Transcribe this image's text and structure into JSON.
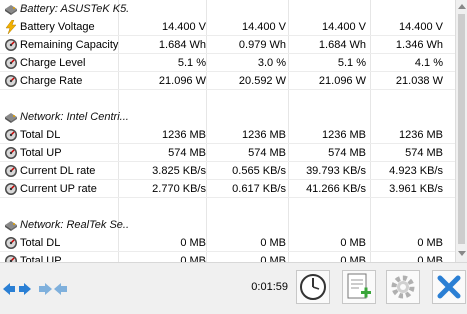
{
  "sections": [
    {
      "title": "Battery: ASUSTeK K5...",
      "icon": "battery-section-icon",
      "rows": [
        {
          "label": "Battery Voltage",
          "icon": "lightning-icon",
          "values": [
            "14.400 V",
            "14.400 V",
            "14.400 V",
            "14.400 V"
          ]
        },
        {
          "label": "Remaining Capacity",
          "icon": "gauge-icon",
          "values": [
            "1.684 Wh",
            "0.979 Wh",
            "1.684 Wh",
            "1.346 Wh"
          ]
        },
        {
          "label": "Charge Level",
          "icon": "gauge-icon",
          "values": [
            "5.1 %",
            "3.0 %",
            "5.1 %",
            "4.1 %"
          ]
        },
        {
          "label": "Charge Rate",
          "icon": "gauge-icon",
          "values": [
            "21.096 W",
            "20.592 W",
            "21.096 W",
            "21.038 W"
          ]
        }
      ]
    },
    {
      "title": "Network: Intel Centri...",
      "icon": "network-section-icon",
      "rows": [
        {
          "label": "Total DL",
          "icon": "gauge-icon",
          "values": [
            "1236 MB",
            "1236 MB",
            "1236 MB",
            "1236 MB"
          ]
        },
        {
          "label": "Total UP",
          "icon": "gauge-icon",
          "values": [
            "574 MB",
            "574 MB",
            "574 MB",
            "574 MB"
          ]
        },
        {
          "label": "Current DL rate",
          "icon": "gauge-icon",
          "values": [
            "3.825 KB/s",
            "0.565 KB/s",
            "39.793 KB/s",
            "4.923 KB/s"
          ]
        },
        {
          "label": "Current UP rate",
          "icon": "gauge-icon",
          "values": [
            "2.770 KB/s",
            "0.617 KB/s",
            "41.266 KB/s",
            "3.961 KB/s"
          ]
        }
      ]
    },
    {
      "title": "Network: RealTek Se...",
      "icon": "network-section-icon",
      "rows": [
        {
          "label": "Total DL",
          "icon": "gauge-icon",
          "values": [
            "0 MB",
            "0 MB",
            "0 MB",
            "0 MB"
          ]
        },
        {
          "label": "Total UP",
          "icon": "gauge-icon",
          "values": [
            "0 MB",
            "0 MB",
            "0 MB",
            "0 MB"
          ]
        }
      ]
    }
  ],
  "toolbar": {
    "timer": "0:01:59",
    "buttons": [
      "expand-button",
      "collapse-button",
      "clock-button",
      "add-report-button",
      "settings-button",
      "close-button"
    ]
  },
  "colors": {
    "accent_blue": "#2a7fd4",
    "gauge_dark": "#4a4a4a",
    "lightning": "#f2b100",
    "add_green": "#3aa53a"
  }
}
